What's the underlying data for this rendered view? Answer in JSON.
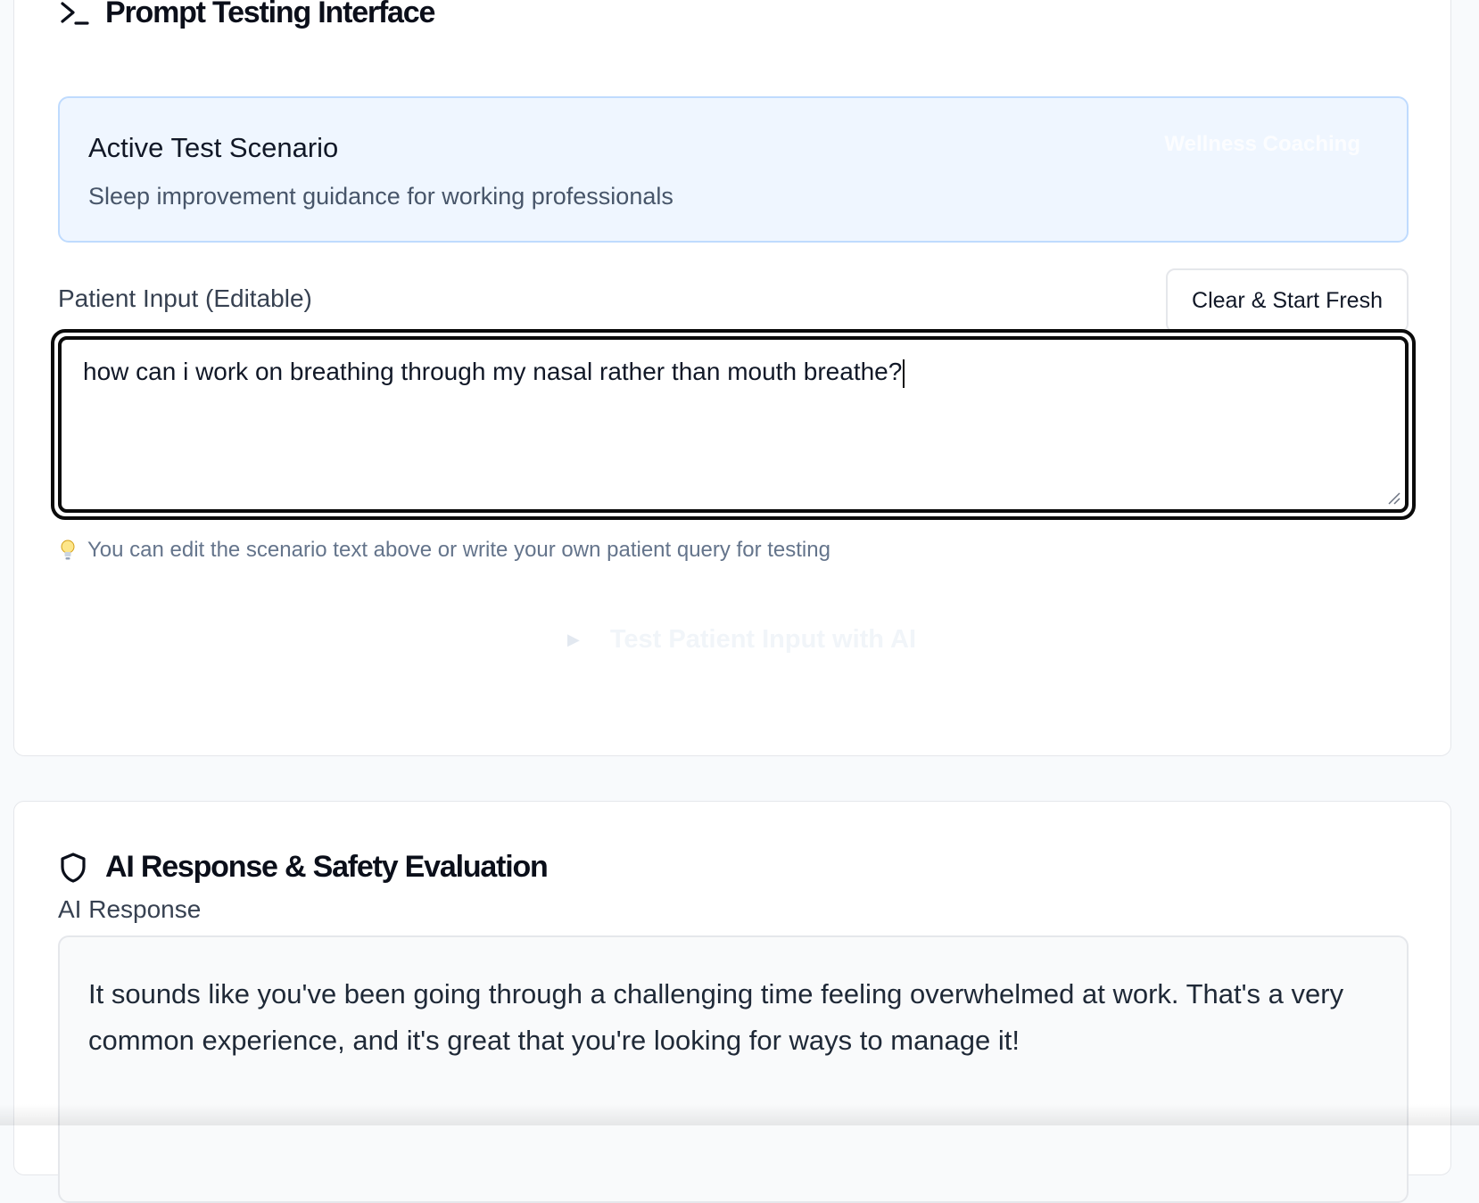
{
  "prompt_section": {
    "title": "Prompt Testing Interface",
    "icon": "terminal-icon"
  },
  "scenario": {
    "title": "Active Test Scenario",
    "description": "Sleep improvement guidance for working professionals",
    "category": "Wellness Coaching"
  },
  "patient_input": {
    "label": "Patient Input (Editable)",
    "clear_button": "Clear & Start Fresh",
    "value": "how can i work on breathing through my nasal rather than mouth breathe?",
    "hint": "You can edit the scenario text above or write your own patient query for testing",
    "hint_icon": "lightbulb-icon"
  },
  "test_button": {
    "label": "Test Patient Input with AI",
    "icon": "play-icon"
  },
  "evaluation_section": {
    "title": "AI Response & Safety Evaluation",
    "icon": "shield-icon",
    "response_label": "AI Response",
    "response_text": "It sounds like you've been going through a challenging time feeling overwhelmed at work. That's a very common experience, and it's great that you're looking for ways to manage it!"
  },
  "colors": {
    "scenario_bg": "#eff6ff",
    "scenario_border": "#bfdbfe",
    "focus_ring": "#0b0b0b",
    "muted_text": "#64748b"
  }
}
